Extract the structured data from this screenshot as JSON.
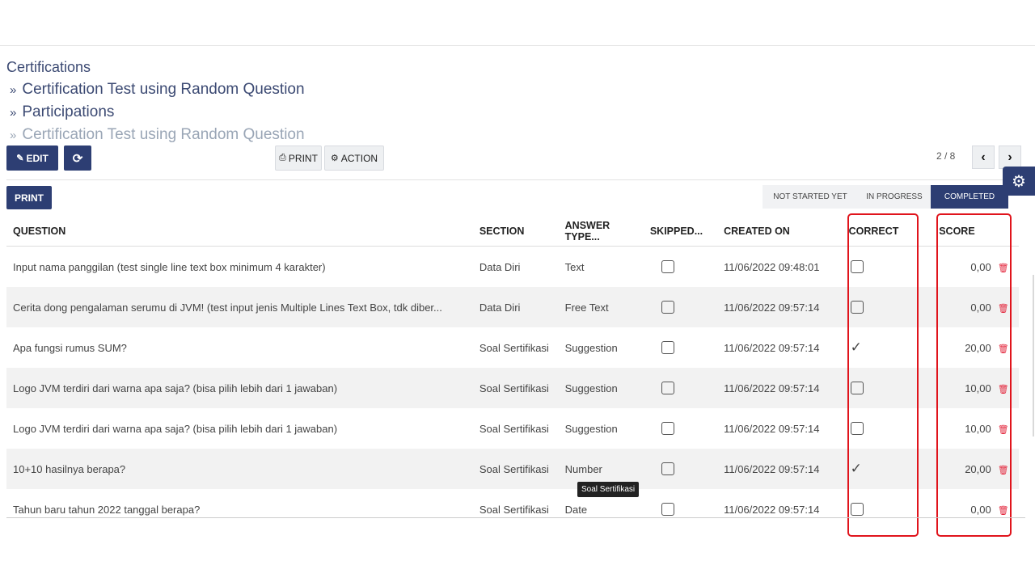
{
  "breadcrumb": {
    "root": "Certifications",
    "items": [
      "Certification Test using Random Question",
      "Participations",
      "Certification Test using Random Question"
    ],
    "sep": "»"
  },
  "toolbar": {
    "edit_label": "EDIT",
    "print_label": "PRINT",
    "action_label": "ACTION",
    "pager": "2 / 8"
  },
  "sheet": {
    "print_label": "PRINT"
  },
  "statusbar": {
    "stages": [
      "NOT STARTED YET",
      "IN PROGRESS",
      "COMPLETED"
    ],
    "active": "COMPLETED"
  },
  "table": {
    "headers": [
      "QUESTION",
      "SECTION",
      "ANSWER TYPE...",
      "SKIPPED...",
      "CREATED ON",
      "CORRECT",
      "SCORE"
    ],
    "rows": [
      {
        "question": "Input nama panggilan (test single line text box minimum 4 karakter)",
        "section": "Data Diri",
        "answer_type": "Text",
        "skipped": false,
        "created_on": "11/06/2022 09:48:01",
        "correct": false,
        "score": "0,00"
      },
      {
        "question": "Cerita dong pengalaman serumu di JVM! (test input jenis Multiple Lines Text Box, tdk diber...",
        "section": "Data Diri",
        "answer_type": "Free Text",
        "skipped": false,
        "created_on": "11/06/2022 09:57:14",
        "correct": false,
        "score": "0,00"
      },
      {
        "question": "Apa fungsi rumus SUM?",
        "section": "Soal Sertifikasi",
        "answer_type": "Suggestion",
        "skipped": false,
        "created_on": "11/06/2022 09:57:14",
        "correct": true,
        "score": "20,00"
      },
      {
        "question": "Logo JVM terdiri dari warna apa saja? (bisa pilih lebih dari 1 jawaban)",
        "section": "Soal Sertifikasi",
        "answer_type": "Suggestion",
        "skipped": false,
        "created_on": "11/06/2022 09:57:14",
        "correct": false,
        "score": "10,00"
      },
      {
        "question": "Logo JVM terdiri dari warna apa saja? (bisa pilih lebih dari 1 jawaban)",
        "section": "Soal Sertifikasi",
        "answer_type": "Suggestion",
        "skipped": false,
        "created_on": "11/06/2022 09:57:14",
        "correct": false,
        "score": "10,00"
      },
      {
        "question": "10+10 hasilnya berapa?",
        "section": "Soal Sertifikasi",
        "answer_type": "Number",
        "skipped": false,
        "created_on": "11/06/2022 09:57:14",
        "correct": true,
        "score": "20,00"
      },
      {
        "question": "Tahun baru tahun 2022 tanggal berapa?",
        "section": "Soal Sertifikasi",
        "answer_type": "Date",
        "skipped": false,
        "created_on": "11/06/2022 09:57:14",
        "correct": false,
        "score": "0,00"
      }
    ]
  },
  "tooltip": "Soal Sertifikasi",
  "colors": {
    "primary": "#2d3e73",
    "highlight": "#e0141c",
    "trash": "#e3263c"
  },
  "icons": {
    "edit": "pencil-icon",
    "refresh": "refresh-icon",
    "print": "printer-icon",
    "action": "gear-icon",
    "prev": "chevron-left-icon",
    "next": "chevron-right-icon",
    "delete": "trash-icon"
  }
}
